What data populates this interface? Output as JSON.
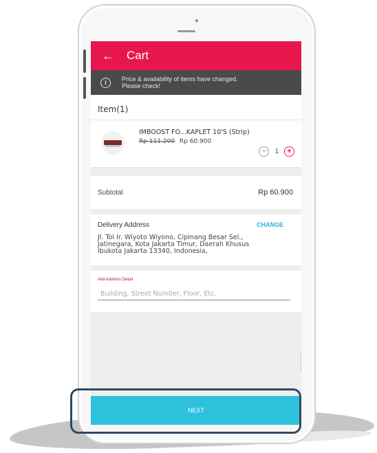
{
  "header": {
    "title": "Cart",
    "back_icon": "arrow-left-icon"
  },
  "notice": {
    "icon": "info-icon",
    "message": "Price & availability of items have changed.\nPlease check!"
  },
  "items": {
    "header": "Item(1)",
    "list": [
      {
        "name": "IMBOOST FO...KAPLET 10'S  (Strip)",
        "old_price": "Rp 111.200",
        "price": "Rp 60.900",
        "quantity": "1"
      }
    ]
  },
  "subtotal": {
    "label": "Subtotal",
    "value": "Rp 60.900"
  },
  "delivery": {
    "title": "Delivery Address",
    "change_label": "CHANGE",
    "address": "Jl. Tol Ir. Wiyoto Wiyono, Cipinang Besar Sel.,\nJatinegara, Kota Jakarta Timur, Daerah Khusus\nIbukota Jakarta 13340, Indonesia,"
  },
  "address_detail": {
    "label": "Add Address Detail",
    "placeholder": "Building, Street Number, Floor, Etc.",
    "value": ""
  },
  "footer": {
    "next_label": "NEXT"
  },
  "colors": {
    "appbar": "#e8174b",
    "notice_bg": "#4a4a4a",
    "accent_link": "#2bb3d9",
    "next_button": "#2dc1dc",
    "highlight_border": "#33475f"
  }
}
